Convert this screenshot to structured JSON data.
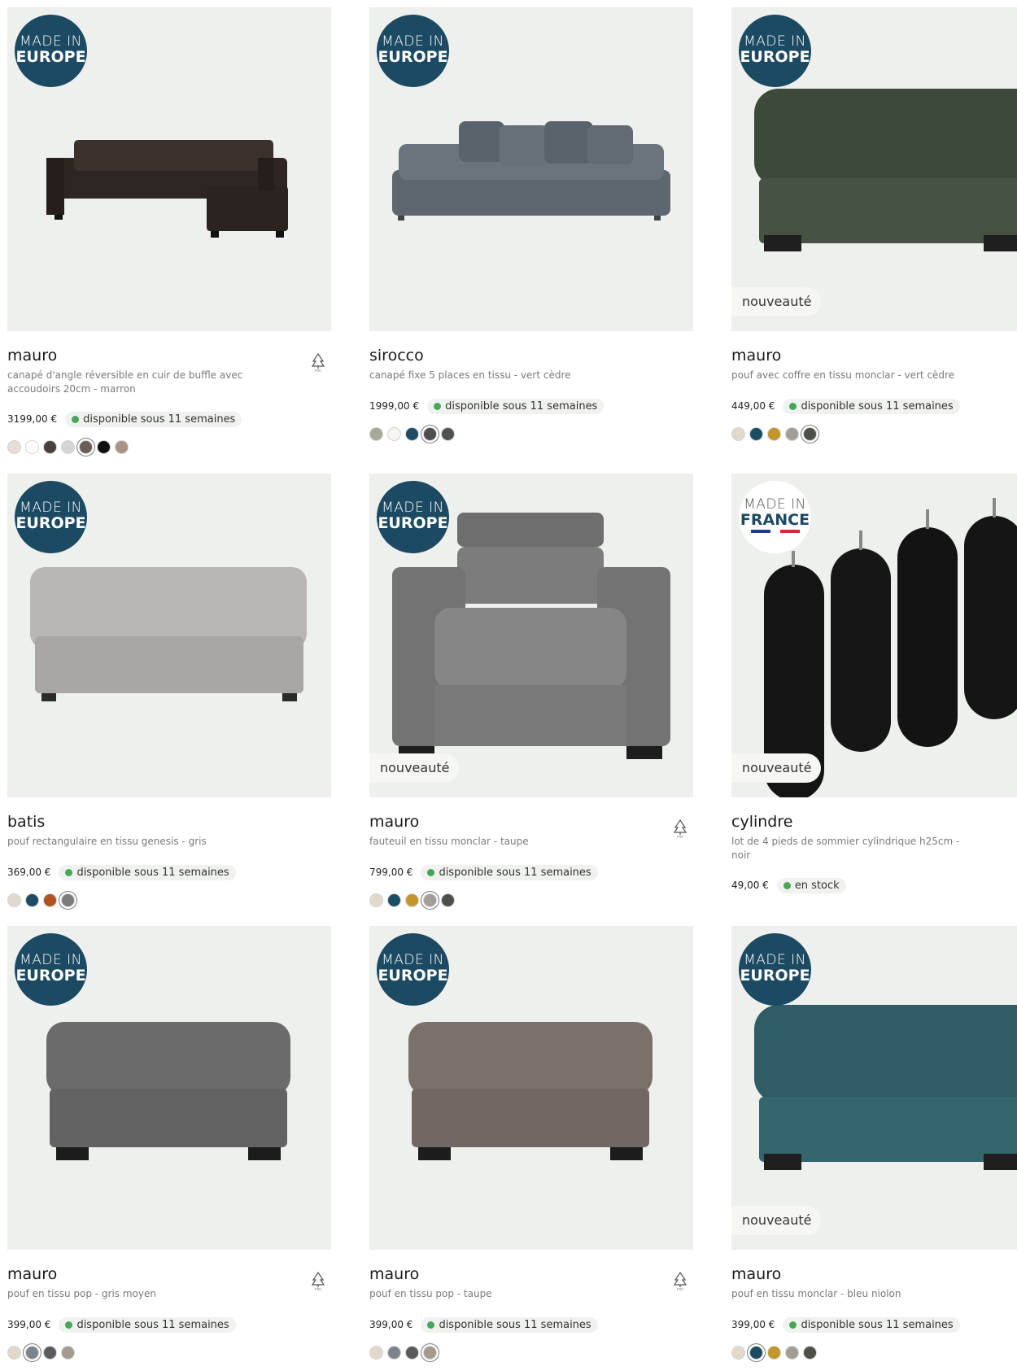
{
  "products": [
    {
      "badge": {
        "line1": "MADE IN",
        "line2": "EUROPE"
      },
      "name": "mauro",
      "desc": "canapé d'angle réversible en cuir de buffle avec accoudoirs 20cm - marron",
      "price": "3199,00 €",
      "availability": "disponible sous 11 semaines",
      "fsc": true,
      "new_label": "",
      "swatches": [
        "#e6ded2",
        "#ffffff",
        "#4a3f3a",
        "#d5d5d5",
        "#6a5e58",
        "#0f0f0f",
        "#a99384"
      ],
      "selected": 4
    },
    {
      "badge": {
        "line1": "MADE IN",
        "line2": "EUROPE"
      },
      "name": "sirocco",
      "desc": "canapé fixe 5 places en tissu - vert cèdre",
      "price": "1999,00 €",
      "availability": "disponible sous 11 semaines",
      "fsc": false,
      "new_label": "",
      "swatches": [
        "#a8a897",
        "#f7f5f0",
        "#1f4b63",
        "#4d4d4f",
        "#4e5252"
      ],
      "selected": 3
    },
    {
      "badge": {
        "line1": "MADE IN",
        "line2": "EUROPE"
      },
      "name": "mauro",
      "desc": "pouf avec coffre en tissu monclar - vert cèdre",
      "price": "449,00 €",
      "availability": "disponible sous 11 semaines",
      "fsc": false,
      "new_label": "nouveauté",
      "swatches": [
        "#e2d9cc",
        "#1b4e63",
        "#c3962c",
        "#a39d97",
        "#4c5049"
      ],
      "selected": 4
    },
    {
      "badge": {
        "line1": "MADE IN",
        "line2": "EUROPE"
      },
      "name": "batis",
      "desc": "pouf rectangulaire en tissu genesis - gris",
      "price": "369,00 €",
      "availability": "disponible sous 11 semaines",
      "fsc": false,
      "new_label": "",
      "swatches": [
        "#e0d9cf",
        "#1d4b63",
        "#b0521f",
        "#7c7c7c"
      ],
      "selected": 3
    },
    {
      "badge": {
        "line1": "MADE IN",
        "line2": "EUROPE"
      },
      "name": "mauro",
      "desc": "fauteuil en tissu monclar - taupe",
      "price": "799,00 €",
      "availability": "disponible sous 11 semaines",
      "fsc": true,
      "new_label": "nouveauté",
      "swatches": [
        "#e2d9cc",
        "#1b4e63",
        "#c3962c",
        "#a39d97",
        "#4c5049"
      ],
      "selected": 3
    },
    {
      "badge": {
        "line1": "MADE IN",
        "line2": "FRANCE",
        "fr": true
      },
      "name": "cylindre",
      "desc": "lot de 4 pieds de sommier cylindrique h25cm - noir",
      "price": "49,00 €",
      "availability": "en stock",
      "fsc": false,
      "new_label": "nouveauté",
      "swatches": [],
      "selected": -1
    },
    {
      "badge": {
        "line1": "MADE IN",
        "line2": "EUROPE"
      },
      "name": "mauro",
      "desc": "pouf en tissu pop - gris moyen",
      "price": "399,00 €",
      "availability": "disponible sous 11 semaines",
      "fsc": true,
      "new_label": "",
      "swatches": [
        "#e2d9cc",
        "#7c8489",
        "#5b5b5b",
        "#a39a90"
      ],
      "selected": 1
    },
    {
      "badge": {
        "line1": "MADE IN",
        "line2": "EUROPE"
      },
      "name": "mauro",
      "desc": "pouf en tissu pop - taupe",
      "price": "399,00 €",
      "availability": "disponible sous 11 semaines",
      "fsc": true,
      "new_label": "",
      "swatches": [
        "#e2d9cc",
        "#7c8489",
        "#5b5b5b",
        "#a39a90"
      ],
      "selected": 3
    },
    {
      "badge": {
        "line1": "MADE IN",
        "line2": "EUROPE"
      },
      "name": "mauro",
      "desc": "pouf en tissu monclar - bleu niolon",
      "price": "399,00 €",
      "availability": "disponible sous 11 semaines",
      "fsc": false,
      "new_label": "nouveauté",
      "swatches": [
        "#e2d9cc",
        "#1b4e63",
        "#c3962c",
        "#a39d97",
        "#4c5049"
      ],
      "selected": 1
    }
  ],
  "colors": {
    "badge": "#1c4a63",
    "available_dot": "#47a65a",
    "image_bg": "#eef0ed"
  },
  "icons": {
    "fsc": "fsc-tree-icon"
  }
}
